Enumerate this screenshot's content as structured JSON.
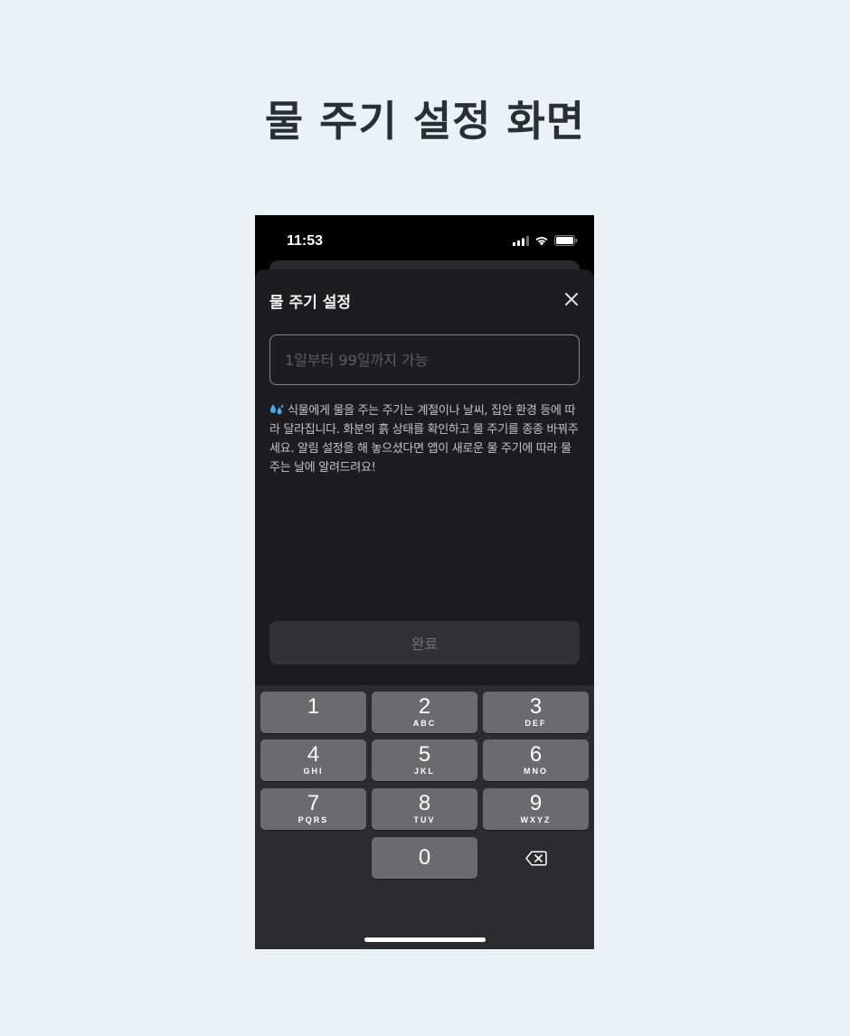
{
  "page": {
    "heading": "물 주기 설정 화면"
  },
  "status_bar": {
    "time": "11:53"
  },
  "sheet": {
    "title": "물 주기 설정",
    "input_placeholder": "1일부터 99일까지 가능",
    "input_value": "",
    "description": "식물에게 물을 주는 주기는 계절이나 날씨, 집안 환경 등에 따라 달라집니다. 화분의 흙 상태를 확인하고 물 주기를 종종 바꿔주세요. 알림 설정을 해 놓으셨다면 앱이 새로운 물 주기에 따라 물 주는 날에 알려드려요!",
    "description_icon": "droplets-emoji",
    "done_label": "완료"
  },
  "keypad": {
    "keys": [
      {
        "num": "1",
        "letters": ""
      },
      {
        "num": "2",
        "letters": "ABC"
      },
      {
        "num": "3",
        "letters": "DEF"
      },
      {
        "num": "4",
        "letters": "GHI"
      },
      {
        "num": "5",
        "letters": "JKL"
      },
      {
        "num": "6",
        "letters": "MNO"
      },
      {
        "num": "7",
        "letters": "PQRS"
      },
      {
        "num": "8",
        "letters": "TUV"
      },
      {
        "num": "9",
        "letters": "WXYZ"
      },
      {
        "num": "0",
        "letters": ""
      }
    ],
    "backspace_icon": "backspace-icon"
  },
  "colors": {
    "background": "#ecf1f6",
    "sheet": "#1d1d1f",
    "keyboard": "#2c2c2e",
    "key": "#6b6b6d",
    "button": "#323235"
  }
}
